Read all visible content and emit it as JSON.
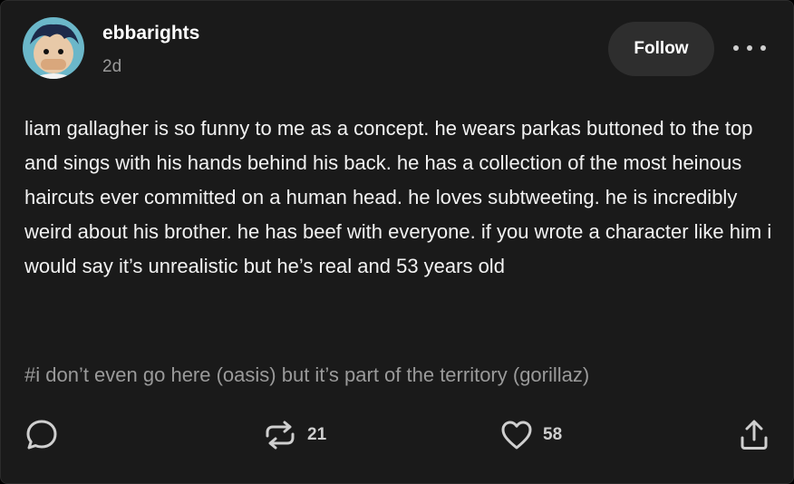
{
  "post": {
    "username": "ebbarights",
    "timestamp": "2d",
    "follow_label": "Follow",
    "body": "liam gallagher is so funny to me as a concept. he wears parkas buttoned to the top and sings with his hands behind his back. he has a collection of the most heinous haircuts ever committed on a human head. he loves subtweeting. he is incredibly weird about his brother. he has beef with everyone. if you wrote a character like him i would say it’s unrealistic but he’s real and 53 years old",
    "tags": "#i don’t even go here (oasis) but it’s part of the territory (gorillaz)"
  },
  "actions": {
    "reply_icon": "speech-bubble-icon",
    "reblog_icon": "reblog-arrows-icon",
    "reblog_count": "21",
    "like_icon": "heart-icon",
    "like_count": "58",
    "share_icon": "share-upload-icon"
  },
  "colors": {
    "background": "#1a1a1a",
    "text": "#f2f2f2",
    "muted": "#9a9a9a",
    "button": "#2e2e2e"
  }
}
